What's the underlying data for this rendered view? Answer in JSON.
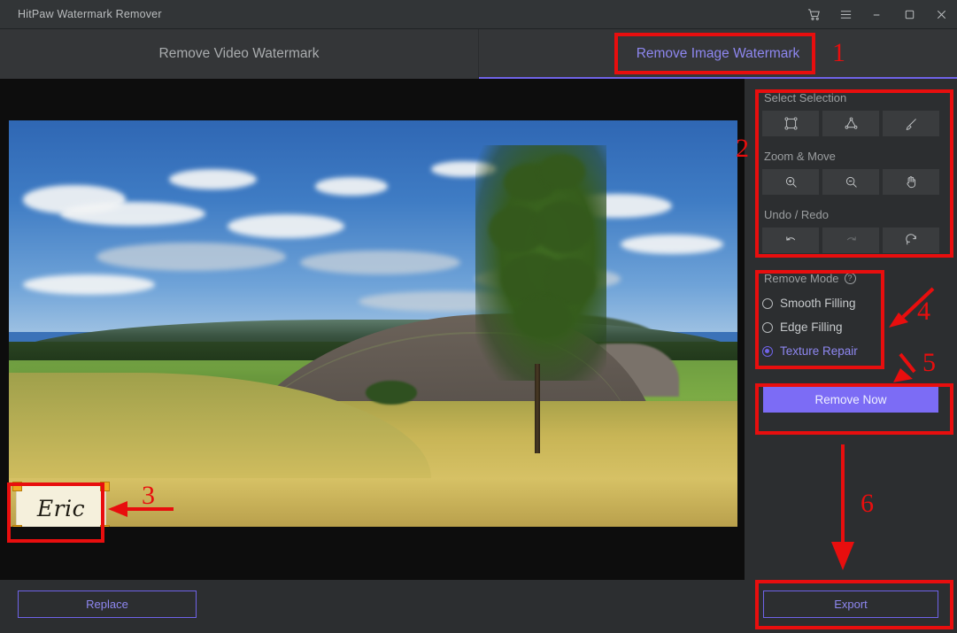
{
  "window": {
    "title": "HitPaw Watermark Remover",
    "controls": [
      {
        "name": "cart-icon",
        "glyph": "cart"
      },
      {
        "name": "menu-icon",
        "glyph": "menu"
      },
      {
        "name": "minimize-icon",
        "glyph": "minimize"
      },
      {
        "name": "maximize-icon",
        "glyph": "maximize"
      },
      {
        "name": "close-icon",
        "glyph": "close"
      }
    ]
  },
  "tabs": {
    "video": "Remove Video Watermark",
    "image": "Remove Image Watermark",
    "active": "image"
  },
  "canvas": {
    "watermark_text": "Eric"
  },
  "sidebar": {
    "select_selection": {
      "label": "Select Selection",
      "tools": [
        {
          "name": "rectangle-select-tool",
          "icon": "rectangle-select-icon"
        },
        {
          "name": "polygon-select-tool",
          "icon": "polygon-select-icon"
        },
        {
          "name": "brush-select-tool",
          "icon": "brush-icon"
        }
      ]
    },
    "zoom_move": {
      "label": "Zoom & Move",
      "tools": [
        {
          "name": "zoom-in-tool",
          "icon": "zoom-in-icon"
        },
        {
          "name": "zoom-out-tool",
          "icon": "zoom-out-icon"
        },
        {
          "name": "pan-tool",
          "icon": "hand-icon"
        }
      ]
    },
    "undo_redo": {
      "label": "Undo / Redo",
      "tools": [
        {
          "name": "undo-button",
          "icon": "undo-icon",
          "enabled": true
        },
        {
          "name": "redo-button",
          "icon": "redo-icon",
          "enabled": false
        },
        {
          "name": "reset-button",
          "icon": "reset-icon",
          "enabled": true
        }
      ]
    },
    "remove_mode": {
      "label": "Remove Mode",
      "help_icon": "question-mark-icon",
      "options": [
        {
          "label": "Smooth Filling",
          "selected": false
        },
        {
          "label": "Edge Filling",
          "selected": false
        },
        {
          "label": "Texture Repair",
          "selected": true
        }
      ]
    },
    "remove_now_label": "Remove Now"
  },
  "bottom": {
    "replace_label": "Replace",
    "export_label": "Export"
  },
  "annotations": {
    "n1": "1",
    "n2": "2",
    "n3": "3",
    "n4": "4",
    "n5": "5",
    "n6": "6"
  },
  "colors": {
    "accent_purple": "#7c6cf5",
    "accent_text": "#8e87f0",
    "annotation_red": "#e80e0e",
    "panel_bg": "#2c2e30",
    "titlebar_bg": "#323537",
    "handle_orange": "#f0a81e"
  }
}
